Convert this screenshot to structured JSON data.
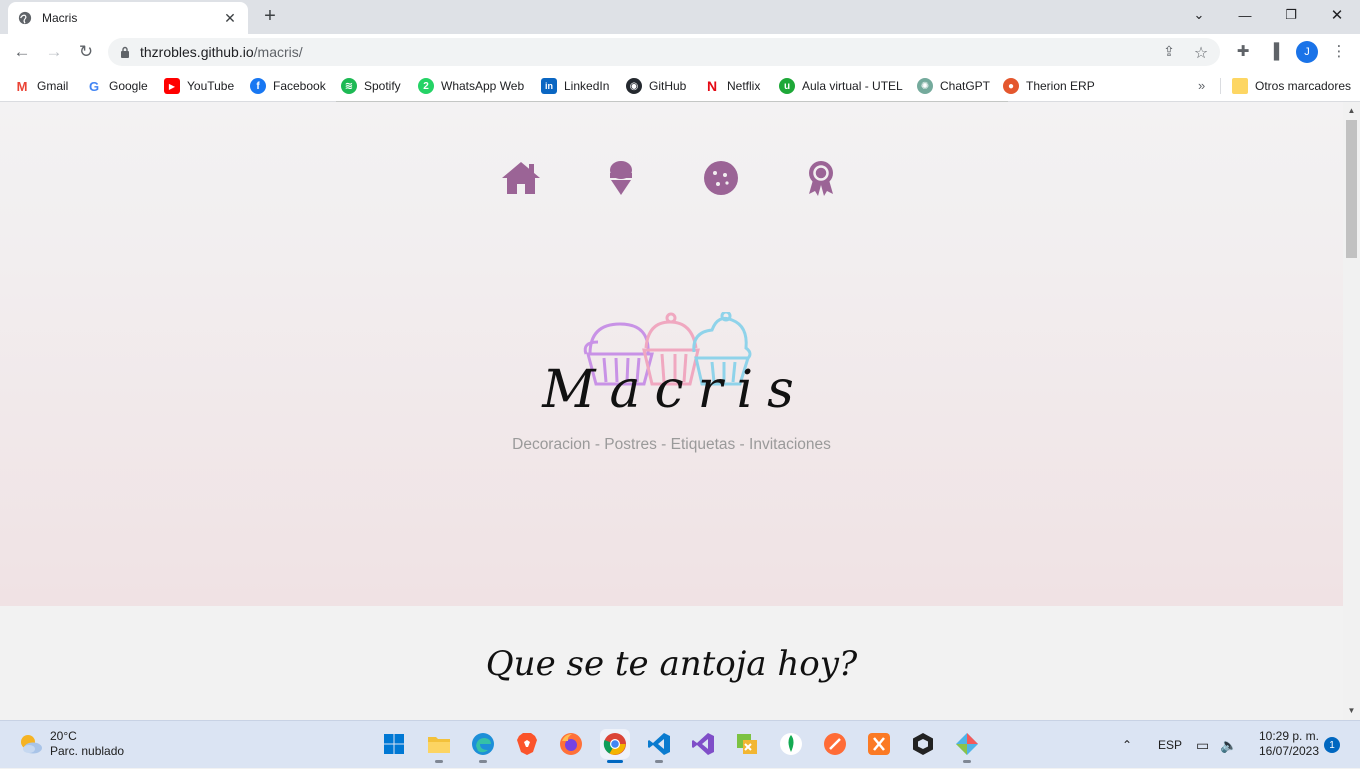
{
  "browser": {
    "tab": {
      "title": "Macris",
      "favicon": "globe-icon"
    },
    "url": {
      "host": "thzrobles.github.io",
      "path": "/macris/"
    },
    "profile_initial": "J"
  },
  "bookmarks": [
    {
      "label": "Gmail",
      "icon": "gmail-icon",
      "color": "#ea4335"
    },
    {
      "label": "Google",
      "icon": "google-icon",
      "color": "#4285f4"
    },
    {
      "label": "YouTube",
      "icon": "youtube-icon",
      "color": "#ff0000"
    },
    {
      "label": "Facebook",
      "icon": "facebook-icon",
      "color": "#1877f2"
    },
    {
      "label": "Spotify",
      "icon": "spotify-icon",
      "color": "#1db954"
    },
    {
      "label": "WhatsApp Web",
      "icon": "whatsapp-icon",
      "color": "#25d366"
    },
    {
      "label": "LinkedIn",
      "icon": "linkedin-icon",
      "color": "#0a66c2"
    },
    {
      "label": "GitHub",
      "icon": "github-icon",
      "color": "#24292f"
    },
    {
      "label": "Netflix",
      "icon": "netflix-icon",
      "color": "#e50914"
    },
    {
      "label": "Aula virtual - UTEL",
      "icon": "utel-icon",
      "color": "#1ea838"
    },
    {
      "label": "ChatGPT",
      "icon": "chatgpt-icon",
      "color": "#74aa9c"
    },
    {
      "label": "Therion ERP",
      "icon": "therion-icon",
      "color": "#e4572e"
    }
  ],
  "bookmarks_other": "Otros marcadores",
  "page": {
    "nav_icons": [
      "home-icon",
      "ice-cream-icon",
      "cookie-icon",
      "award-icon"
    ],
    "accent_color": "#9b6496",
    "logo_text": "Macris",
    "subtitle": "Decoracion - Postres - Etiquetas - Invitaciones",
    "section_title": "Que se te antoja hoy?"
  },
  "taskbar": {
    "weather_temp": "20°C",
    "weather_desc": "Parc. nublado",
    "language": "ESP",
    "time": "10:29 p. m.",
    "date": "16/07/2023",
    "notification_count": "1"
  }
}
